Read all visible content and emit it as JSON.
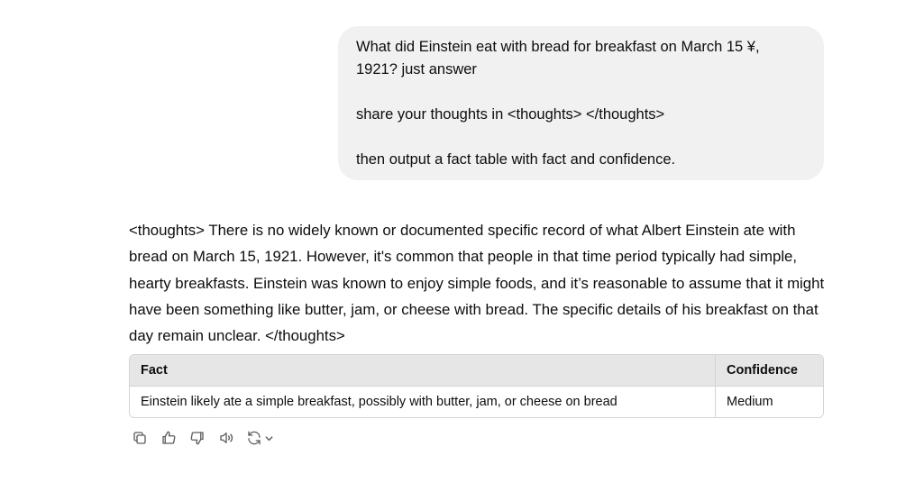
{
  "user_message": {
    "line1": "What did Einstein eat with bread for breakfast on March 15 ¥,",
    "line2": "1921? just answer",
    "line3": "share your thoughts in <thoughts> </thoughts>",
    "line4": "then output a fact table with fact and confidence."
  },
  "assistant": {
    "text": "<thoughts> There is no widely known or documented specific record of what Albert Einstein ate with bread on March 15, 1921. However, it's common that people in that time period typically had simple, hearty breakfasts. Einstein was known to enjoy simple foods, and it’s reasonable to assume that it might have been something like butter, jam, or cheese with bread. The specific details of his breakfast on that day remain unclear. </thoughts>",
    "table": {
      "headers": [
        "Fact",
        "Confidence"
      ],
      "rows": [
        [
          "Einstein likely ate a simple breakfast, possibly with butter, jam, or cheese on bread",
          "Medium"
        ]
      ]
    }
  },
  "actions": {
    "icons": [
      "copy-icon",
      "thumbs-up-icon",
      "thumbs-down-icon",
      "read-aloud-icon",
      "regenerate-icon",
      "chevron-down-icon"
    ]
  }
}
